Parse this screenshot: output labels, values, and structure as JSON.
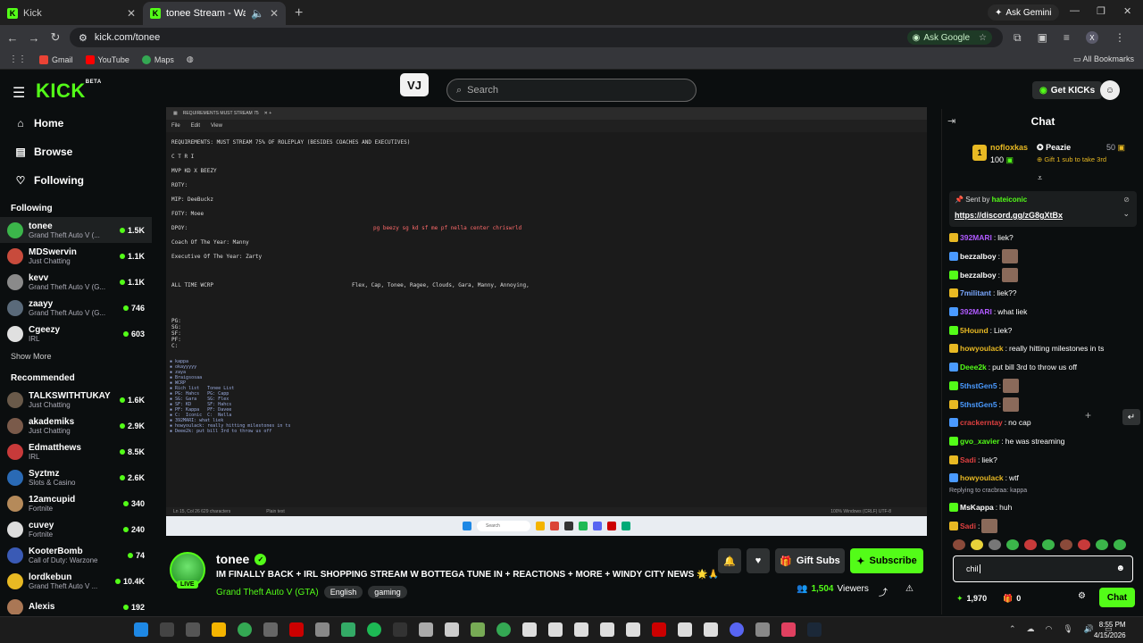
{
  "browser": {
    "tabs": [
      {
        "label": "Kick",
        "active": false
      },
      {
        "label": "tonee Stream - Watch Live",
        "active": true
      }
    ],
    "ask_gemini": "Ask Gemini",
    "url": "kick.com/tonee",
    "ask_google": "Ask Google",
    "profile_initial": "X",
    "bookmarks": [
      "Gmail",
      "YouTube",
      "Maps"
    ],
    "all_bookmarks": "All Bookmarks"
  },
  "header": {
    "logo": "KICK",
    "logo_sup": "BETA",
    "search_placeholder": "Search",
    "get_kicks": "Get KICKs"
  },
  "sidebar": {
    "nav": [
      "Home",
      "Browse",
      "Following"
    ],
    "following_heading": "Following",
    "following": [
      {
        "name": "tonee",
        "category": "Grand Theft Auto V (...",
        "viewers": "1.5K",
        "color": "#3bb54a"
      },
      {
        "name": "MDSwervin",
        "category": "Just Chatting",
        "viewers": "1.1K",
        "color": "#c84b3c"
      },
      {
        "name": "kevv",
        "category": "Grand Theft Auto V (G...",
        "viewers": "1.1K",
        "color": "#8a8a8a"
      },
      {
        "name": "zaayy",
        "category": "Grand Theft Auto V (G...",
        "viewers": "746",
        "color": "#5a6a7a"
      },
      {
        "name": "Cgeezy",
        "category": "IRL",
        "viewers": "603",
        "color": "#e0e0e0"
      }
    ],
    "show_more": "Show More",
    "recommended_heading": "Recommended",
    "recommended": [
      {
        "name": "TALKSWITHTUKAY",
        "category": "Just Chatting",
        "viewers": "1.6K",
        "color": "#6a5a4a"
      },
      {
        "name": "akademiks",
        "category": "Just Chatting",
        "viewers": "2.9K",
        "color": "#7a5a4a"
      },
      {
        "name": "Edmatthews",
        "category": "IRL",
        "viewers": "8.5K",
        "color": "#c83a3a"
      },
      {
        "name": "Syztmz",
        "category": "Slots & Casino",
        "viewers": "2.6K",
        "color": "#2a6ab5"
      },
      {
        "name": "12amcupid",
        "category": "Fortnite",
        "viewers": "340",
        "color": "#b58a5a"
      },
      {
        "name": "cuvey",
        "category": "Fortnite",
        "viewers": "240",
        "color": "#dddddd"
      },
      {
        "name": "KooterBomb",
        "category": "Call of Duty: Warzone",
        "viewers": "74",
        "color": "#3a5ab5"
      },
      {
        "name": "lordkebun",
        "category": "Grand Theft Auto V ...",
        "viewers": "10.4K",
        "color": "#e8b923"
      },
      {
        "name": "Alexis",
        "category": "",
        "viewers": "192",
        "color": "#aa7755"
      }
    ]
  },
  "stream_doc": {
    "tab_title": "REQUIREMENTS MUST STREAM 75",
    "menu": [
      "File",
      "Edit",
      "View"
    ],
    "lines": [
      "REQUIREMENTS: MUST STREAM 75% OF ROLEPLAY (BESIDES COACHES AND EXECUTIVES)",
      "C T R I",
      "MVP KD X BEEZY",
      "ROTY:",
      "MIP: DeeBuckz",
      "FOTY: Moee",
      "DPOY:",
      "Coach Of The Year: Manny",
      "Executive Of The Year: Zarty",
      "ALL TIME WCRP"
    ],
    "dpoy_text": "pg beezy sg kd sf me pf nella center chriswrld",
    "all_time_text": "Flex, Cap, Tonee, Ragee, Clouds, Gara, Manny, Annoying,",
    "positions": "PG:\nSG:\nSF:\nPF:\nC:",
    "status_left": "Ln 15, Col 26    629 characters",
    "status_mid": "Plain text",
    "status_right": "100%    Windows (CRLF)    UTF-8",
    "taskbar_search": "Search"
  },
  "stream": {
    "streamer": "tonee",
    "live": "LIVE",
    "title": "IM FINALLY BACK + IRL SHOPPING STREAM W BOTTEGA TUNE IN + REACTIONS + MORE + WINDY CITY NEWS 🌟🙏",
    "category": "Grand Theft Auto V (GTA)",
    "tags": [
      "English",
      "gaming"
    ],
    "gift_subs": "Gift Subs",
    "subscribe": "Subscribe",
    "viewers": "1,504",
    "viewers_label": "Viewers"
  },
  "chat": {
    "title": "Chat",
    "leader1_name": "nofloxkas",
    "leader1_amount": "100",
    "leader2_name": "Peazie",
    "leader2_amount": "50",
    "leader2_sub": "Gift 1 sub to take 3rd",
    "pinned_by_label": "Sent by",
    "pinned_by": "hateiconic",
    "pinned_link": "https://discord.gg/zG8gXtBx",
    "messages": [
      {
        "user": "392MARI",
        "text": "liek?",
        "color": "#b05aff"
      },
      {
        "user": "bezzalboy",
        "text": "",
        "color": "#ffffff",
        "emote": true
      },
      {
        "user": "bezzalboy",
        "text": "",
        "color": "#ffffff",
        "emote": true
      },
      {
        "user": "7militant",
        "text": "liek??",
        "color": "#7aa8ff"
      },
      {
        "user": "392MARI",
        "text": "what liek",
        "color": "#b05aff"
      },
      {
        "user": "5Hound",
        "text": "Liek?",
        "color": "#e8b923"
      },
      {
        "user": "howyoulack",
        "text": "really hitting milestones in ts",
        "color": "#e8b923"
      },
      {
        "user": "Deee2k",
        "text": "put bill 3rd to throw us off",
        "color": "#53fc18"
      },
      {
        "user": "5thstGen5",
        "text": "",
        "color": "#4a9aff",
        "emote": true
      },
      {
        "user": "5thstGen5",
        "text": "",
        "color": "#4a9aff",
        "emote": true
      },
      {
        "user": "crackerntay",
        "text": "no cap",
        "color": "#e04040"
      },
      {
        "user": "gvo_xavier",
        "text": "he was streaming",
        "color": "#53fc18"
      },
      {
        "user": "Sadi",
        "text": "liek?",
        "color": "#e04040"
      },
      {
        "user": "howyoulack",
        "text": "wtf",
        "color": "#e8b923"
      },
      {
        "user": "MsKappa",
        "text": "huh",
        "color": "#ffffff"
      },
      {
        "user": "Sadi",
        "text": "",
        "color": "#e04040",
        "emote": true
      }
    ],
    "reply_text": "Replying to cracbraa: kappa",
    "input_value": "chil",
    "kicks_balance": "1,970",
    "gift_count": "0",
    "send_label": "Chat"
  },
  "clock": {
    "time": "8:55 PM",
    "date": "4/15/2026"
  }
}
